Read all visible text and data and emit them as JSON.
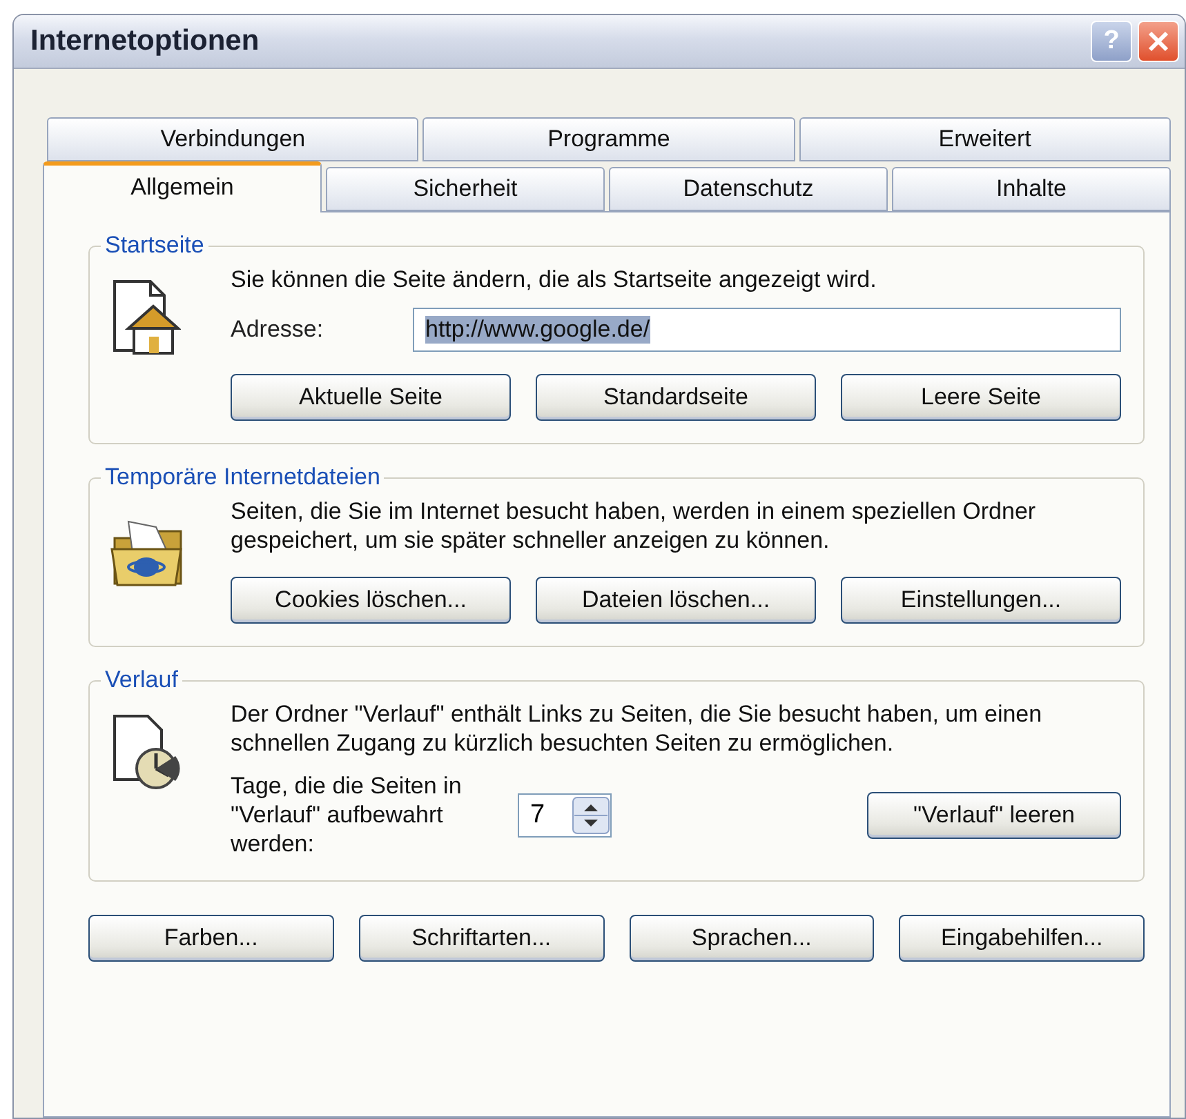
{
  "window": {
    "title": "Internetoptionen",
    "help": "?"
  },
  "tab_rows": [
    [
      {
        "label": "Verbindungen",
        "selected": false
      },
      {
        "label": "Programme",
        "selected": false
      },
      {
        "label": "Erweitert",
        "selected": false
      }
    ],
    [
      {
        "label": "Allgemein",
        "selected": true
      },
      {
        "label": "Sicherheit",
        "selected": false
      },
      {
        "label": "Datenschutz",
        "selected": false
      },
      {
        "label": "Inhalte",
        "selected": false
      }
    ]
  ],
  "groups": [
    {
      "legend": "Startseite",
      "kind": "homepage",
      "description": "Sie können die Seite ändern, die als Startseite angezeigt wird.",
      "field": {
        "label": "Adresse:",
        "value": "http://www.google.de/",
        "selected": true
      },
      "buttons": [
        "Aktuelle Seite",
        "Standardseite",
        "Leere Seite"
      ]
    },
    {
      "legend": "Temporäre Internetdateien",
      "kind": "cache",
      "description": "Seiten, die Sie im Internet besucht haben, werden in einem speziellen Ordner gespeichert, um sie später schneller anzeigen zu können.",
      "buttons": [
        "Cookies löschen...",
        "Dateien löschen...",
        "Einstellungen..."
      ]
    },
    {
      "legend": "Verlauf",
      "kind": "history",
      "description": "Der Ordner \"Verlauf\" enthält Links zu Seiten, die Sie besucht haben, um einen schnellen Zugang zu kürzlich besuchten Seiten zu ermöglichen.",
      "days": {
        "label": "Tage, die die Seiten in \"Verlauf\" aufbewahrt werden:",
        "value": "7"
      },
      "buttons": [
        "\"Verlauf\" leeren"
      ]
    }
  ],
  "bottom_buttons": [
    "Farben...",
    "Schriftarten...",
    "Sprachen...",
    "Eingabehilfen..."
  ]
}
